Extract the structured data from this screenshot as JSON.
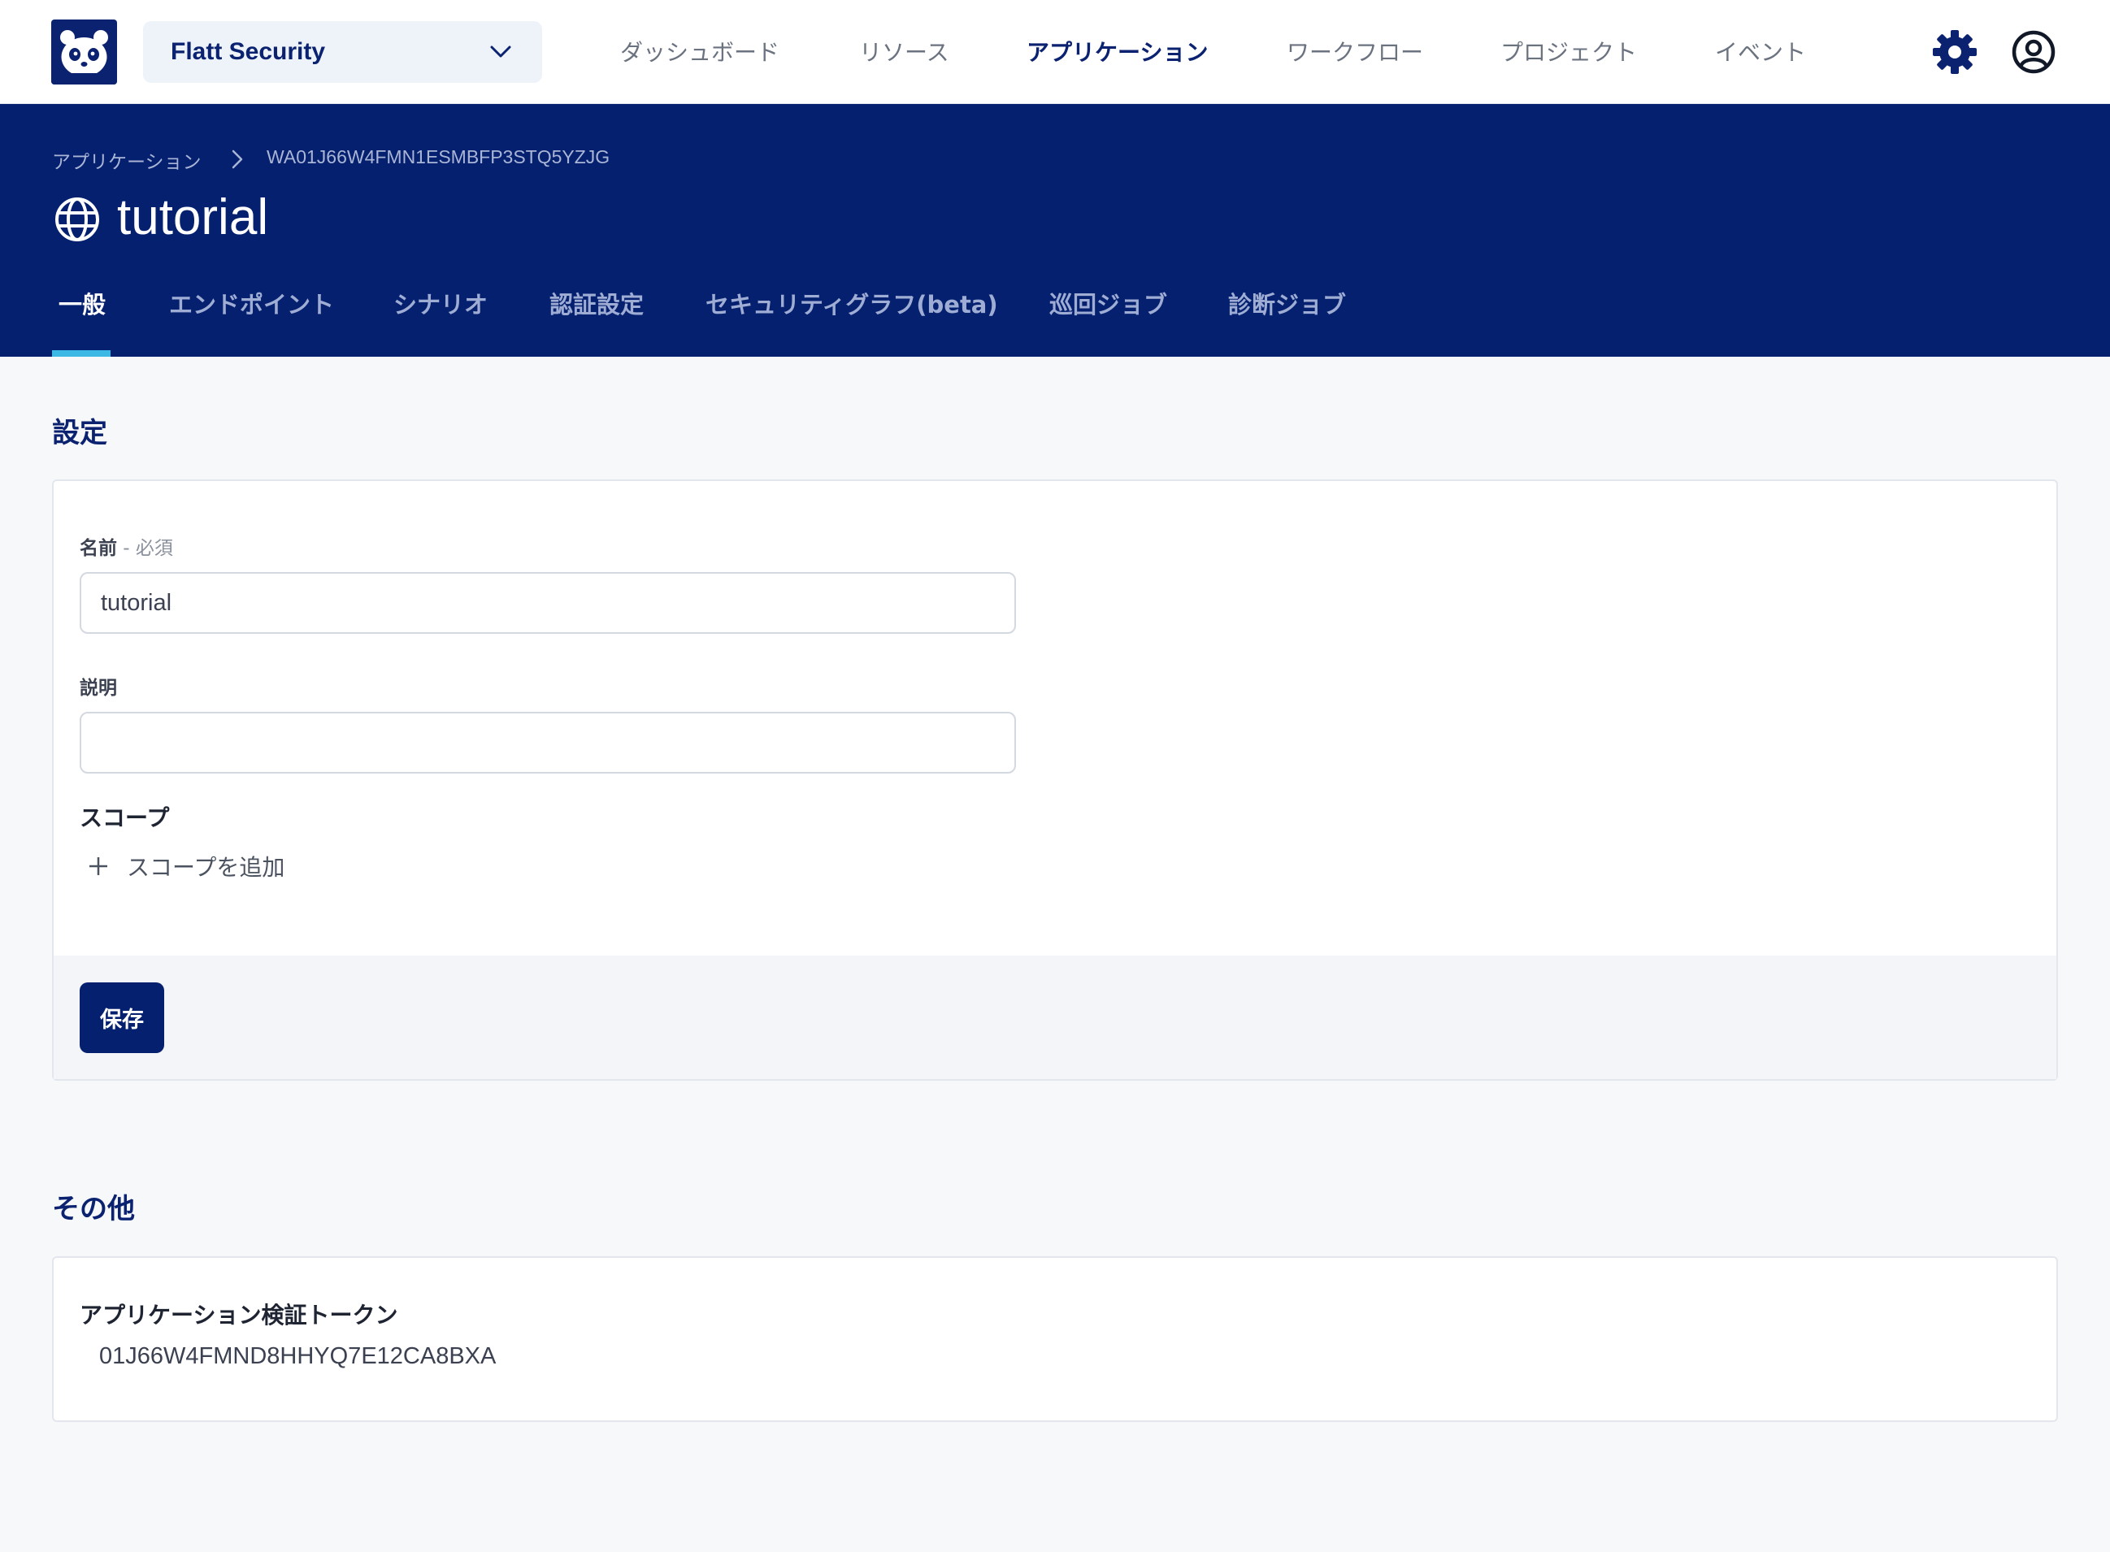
{
  "topbar": {
    "org_selector": {
      "value": "Flatt Security"
    },
    "nav": [
      {
        "label": "ダッシュボード",
        "active": false
      },
      {
        "label": "リソース",
        "active": false
      },
      {
        "label": "アプリケーション",
        "active": true
      },
      {
        "label": "ワークフロー",
        "active": false
      },
      {
        "label": "プロジェクト",
        "active": false
      },
      {
        "label": "イベント",
        "active": false
      }
    ],
    "icons": {
      "logo": "panda-logo-icon",
      "settings": "gear-icon",
      "user": "user-circle-icon"
    }
  },
  "header": {
    "breadcrumb": [
      "アプリケーション",
      "WA01J66W4FMN1ESMBFP3STQ5YZJG"
    ],
    "title": "tutorial",
    "title_icon": "globe-icon",
    "tabs": [
      {
        "label": "一般",
        "active": true
      },
      {
        "label": "エンドポイント",
        "active": false
      },
      {
        "label": "シナリオ",
        "active": false
      },
      {
        "label": "認証設定",
        "active": false
      },
      {
        "label": "セキュリティグラフ(beta)",
        "active": false
      },
      {
        "label": "巡回ジョブ",
        "active": false
      },
      {
        "label": "診断ジョブ",
        "active": false
      }
    ]
  },
  "settings": {
    "title": "設定",
    "name_label": "名前",
    "name_required": " - 必須",
    "name_value": "tutorial",
    "description_label": "説明",
    "description_value": "",
    "scope_title": "スコープ",
    "add_scope": "スコープを追加",
    "save": "保存"
  },
  "other": {
    "title": "その他",
    "token_label": "アプリケーション検証トークン",
    "token_value": "01J66W4FMND8HHYQ7E12CA8BXA"
  },
  "colors": {
    "brand_navy": "#04206f",
    "tab_accent": "#3bb8e3",
    "page_bg": "#f7f8fa"
  }
}
